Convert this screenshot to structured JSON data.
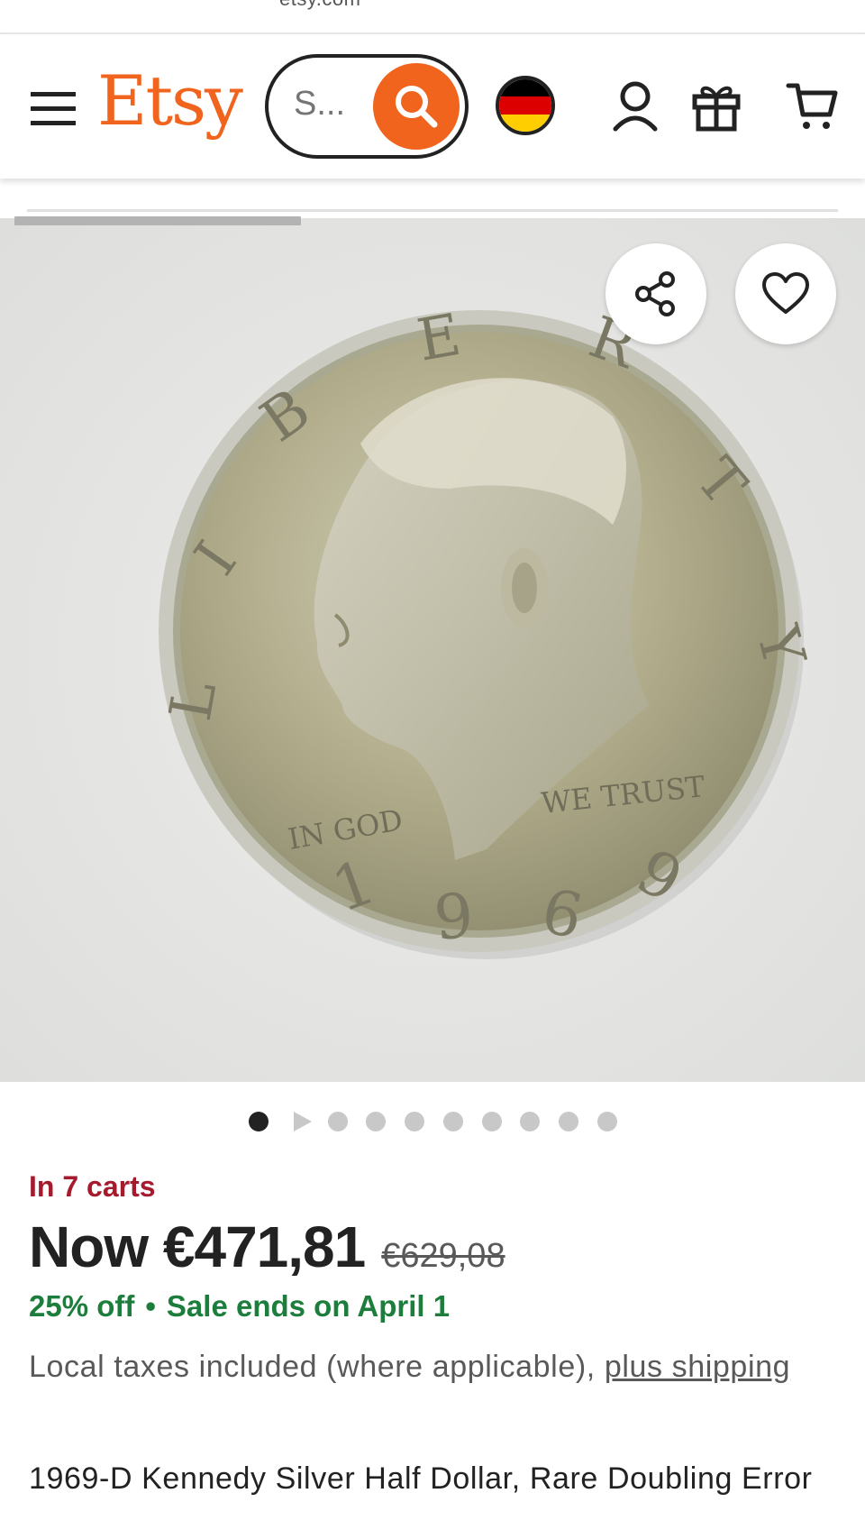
{
  "browser": {
    "url_fragment": "etsy.com"
  },
  "header": {
    "logo": "Etsy",
    "search_placeholder": "S...",
    "region_flag": "Germany",
    "icons": [
      "menu-icon",
      "search-icon",
      "account-icon",
      "gift-icon",
      "cart-icon"
    ]
  },
  "gallery": {
    "image_count": 10,
    "active_index": 0,
    "second_item_is_video": true,
    "image_caption": "Kennedy half dollar coin, 1969"
  },
  "listing": {
    "carts_text": "In 7 carts",
    "price_now": "Now €471,81",
    "price_original": "€629,08",
    "discount": "25% off",
    "separator": "•",
    "sale_end": "Sale ends on April 1",
    "tax_text": "Local taxes included (where applicable),",
    "shipping_link": "plus shipping",
    "title": "1969-D Kennedy Silver Half Dollar, Rare Doubling Error"
  },
  "colors": {
    "brand": "#f1641e",
    "carts": "#a61a2e",
    "sale": "#1d7d3c",
    "text": "#222222",
    "muted": "#595959"
  }
}
